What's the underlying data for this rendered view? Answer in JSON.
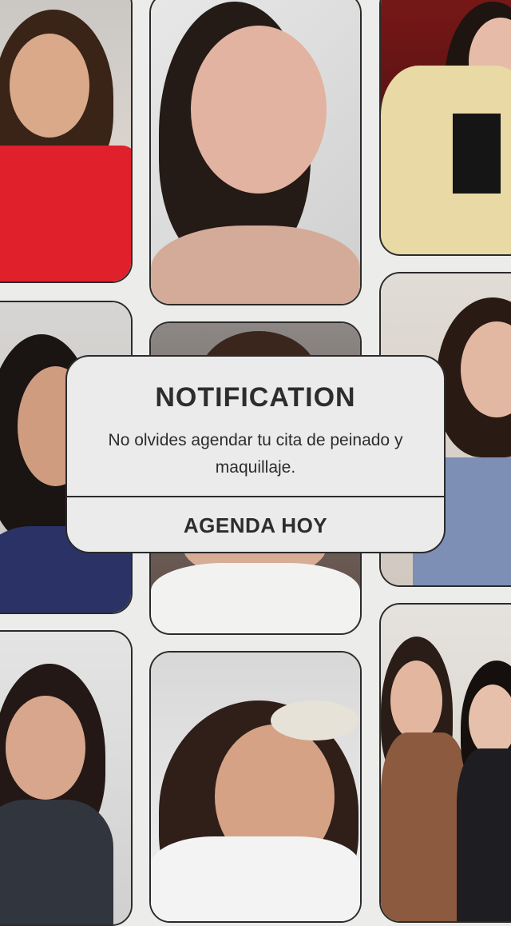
{
  "notification": {
    "title": "NOTIFICATION",
    "message": "No olvides agendar tu cita de peinado y maquillaje.",
    "action_label": "AGENDA HOY"
  },
  "gallery": {
    "tiles": [
      {
        "name": "photo-red-dress"
      },
      {
        "name": "photo-eye-makeup-brush"
      },
      {
        "name": "photo-satin-robe"
      },
      {
        "name": "photo-navy-robe"
      },
      {
        "name": "photo-lip-application"
      },
      {
        "name": "photo-blue-sequin-dress"
      },
      {
        "name": "photo-hair-styling"
      },
      {
        "name": "photo-pearl-headband"
      },
      {
        "name": "photo-two-women"
      }
    ]
  },
  "colors": {
    "background": "#ececeb",
    "card_background": "#ebebeb",
    "border": "#2b2b2b",
    "text": "#2d2d2d"
  }
}
